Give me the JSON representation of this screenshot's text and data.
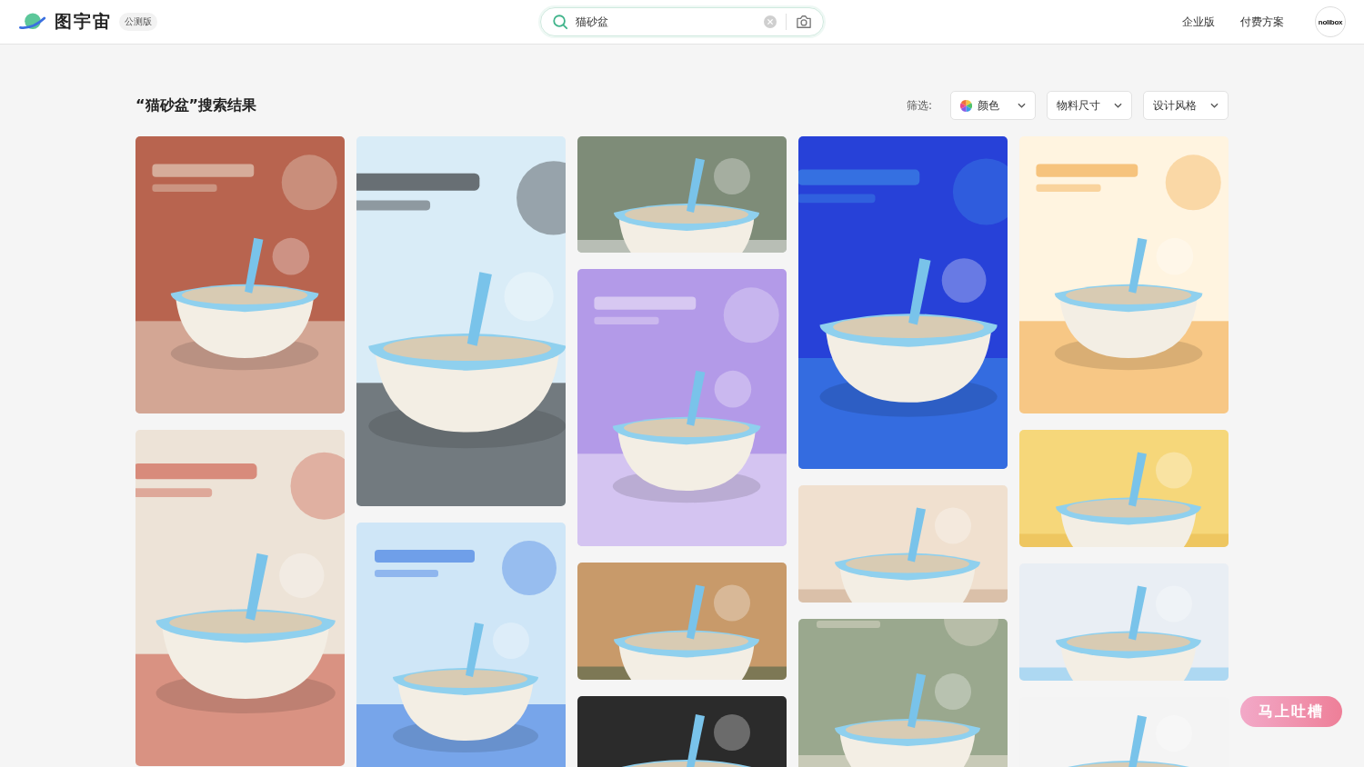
{
  "header": {
    "logo_text": "图宇宙",
    "badge": "公测版",
    "search": {
      "value": "猫砂盆"
    },
    "nav": [
      "企业版",
      "付费方案"
    ],
    "avatar_text": "nolibox"
  },
  "results": {
    "title": "“猫砂盆”搜索结果",
    "filter_label": "筛选:",
    "filters": [
      {
        "label": "颜色",
        "kind": "color"
      },
      {
        "label": "物料尺寸",
        "kind": "plain"
      },
      {
        "label": "设计风格",
        "kind": "plain"
      }
    ]
  },
  "feedback_button": "马上吐槽"
}
